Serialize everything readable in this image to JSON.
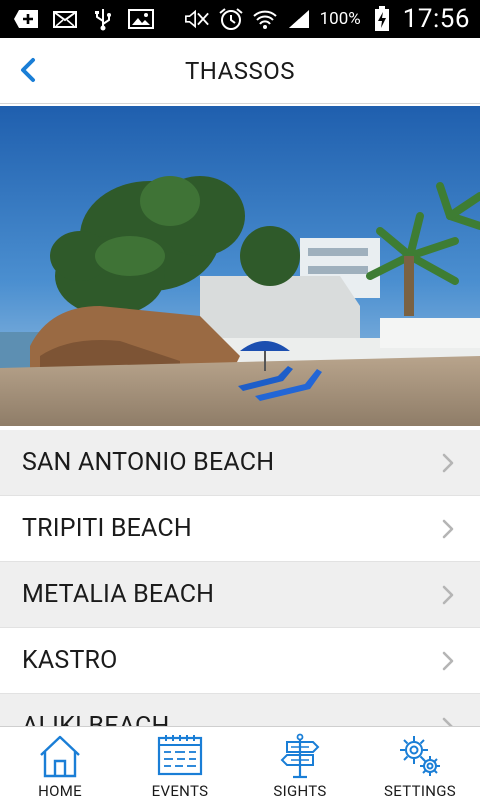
{
  "status_bar": {
    "icons_left": [
      "add-icon",
      "mail-icon",
      "usb-icon",
      "image-icon"
    ],
    "icons_right": [
      "mute-icon",
      "alarm-icon",
      "wifi-icon",
      "signal-icon"
    ],
    "battery": "100%",
    "time": "17:56"
  },
  "header": {
    "title": "THASSOS",
    "back_icon": "chevron-left-icon"
  },
  "hero": {
    "description_icon": "beach-photo"
  },
  "list": {
    "items": [
      {
        "label": "SAN ANTONIO BEACH"
      },
      {
        "label": "TRIPITI BEACH"
      },
      {
        "label": "METALIA BEACH"
      },
      {
        "label": "KASTRO"
      },
      {
        "label": "ALIKI BEACH"
      }
    ]
  },
  "tabbar": {
    "tabs": [
      {
        "label": "HOME",
        "icon": "home-icon"
      },
      {
        "label": "EVENTS",
        "icon": "calendar-icon"
      },
      {
        "label": "SIGHTS",
        "icon": "signpost-icon"
      },
      {
        "label": "SETTINGS",
        "icon": "gears-icon"
      }
    ]
  },
  "colors": {
    "accent": "#1a7ed6",
    "status_bar": "#000000",
    "alt_row": "#efefef"
  }
}
